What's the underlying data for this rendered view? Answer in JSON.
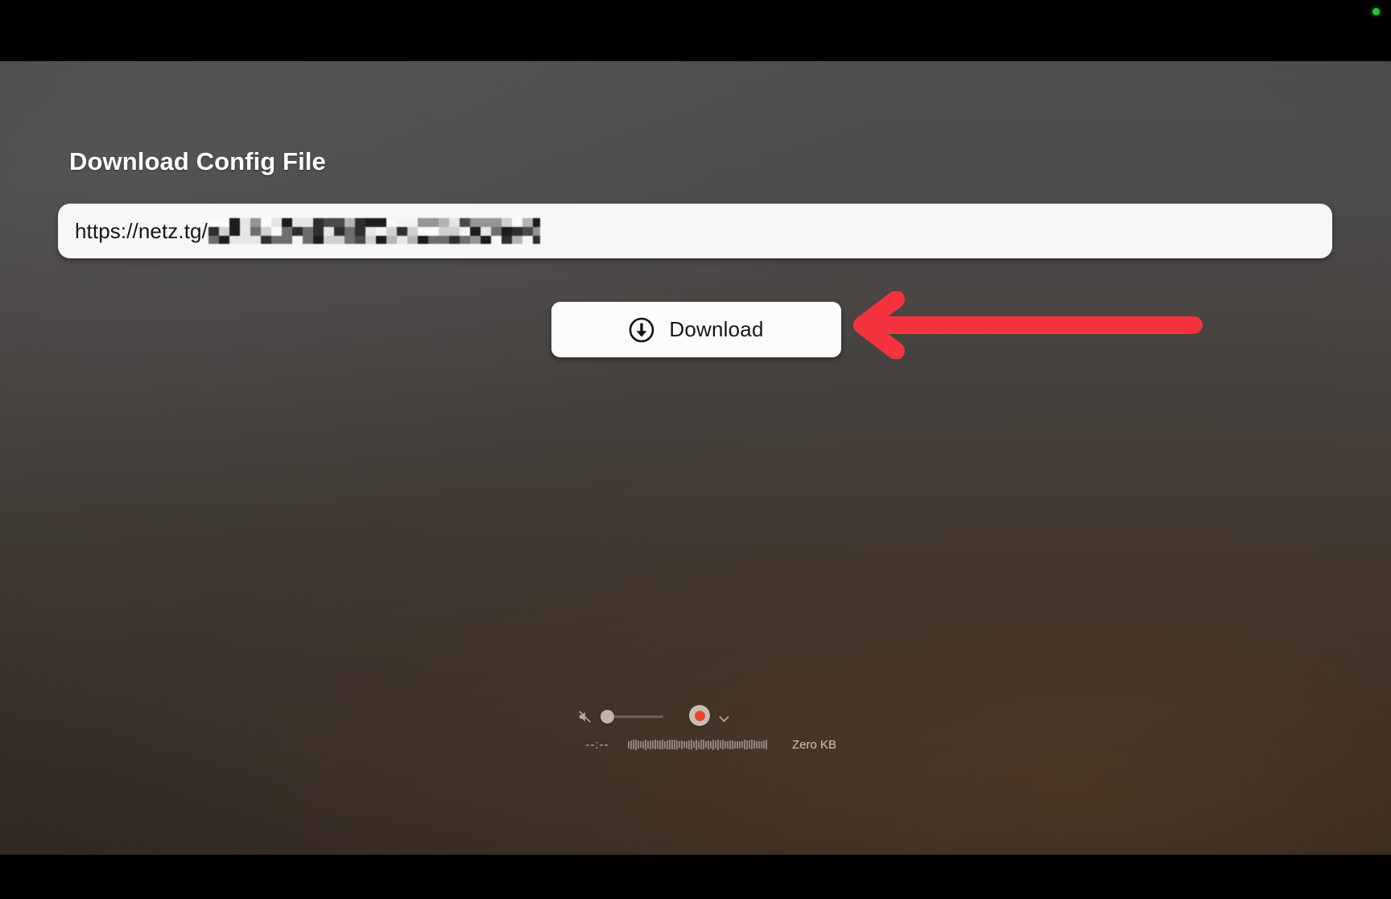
{
  "window": {
    "status_dot_color": "#2bbf3f",
    "letterbox_color": "#000000"
  },
  "page": {
    "title": "Download Config File",
    "background_top_color": "#504f4e",
    "background_bottom_color": "#362d26"
  },
  "url_field": {
    "visible_value": "https://netz.tg/",
    "placeholder": "https://",
    "redacted": true,
    "background_color": "#f7f7f6"
  },
  "download_button": {
    "label": "Download",
    "icon": "download-circle-icon",
    "background_color": "#fcfcfc",
    "text_color": "#16171a"
  },
  "annotation": {
    "type": "left-arrow",
    "color": "#f5333f"
  },
  "media_panel": {
    "mute_icon": "speaker-muted-icon",
    "volume": {
      "value": 0,
      "thumb_color": "#bdb3aa",
      "track_color": "#6d6158"
    },
    "record_button": {
      "label": "record",
      "dot_color": "#f0432c",
      "ring_color": "#c8beb5"
    },
    "chevron_icon": "chevron-down-icon",
    "time": "--:--",
    "size": "Zero KB",
    "waveform_bars": 58
  }
}
